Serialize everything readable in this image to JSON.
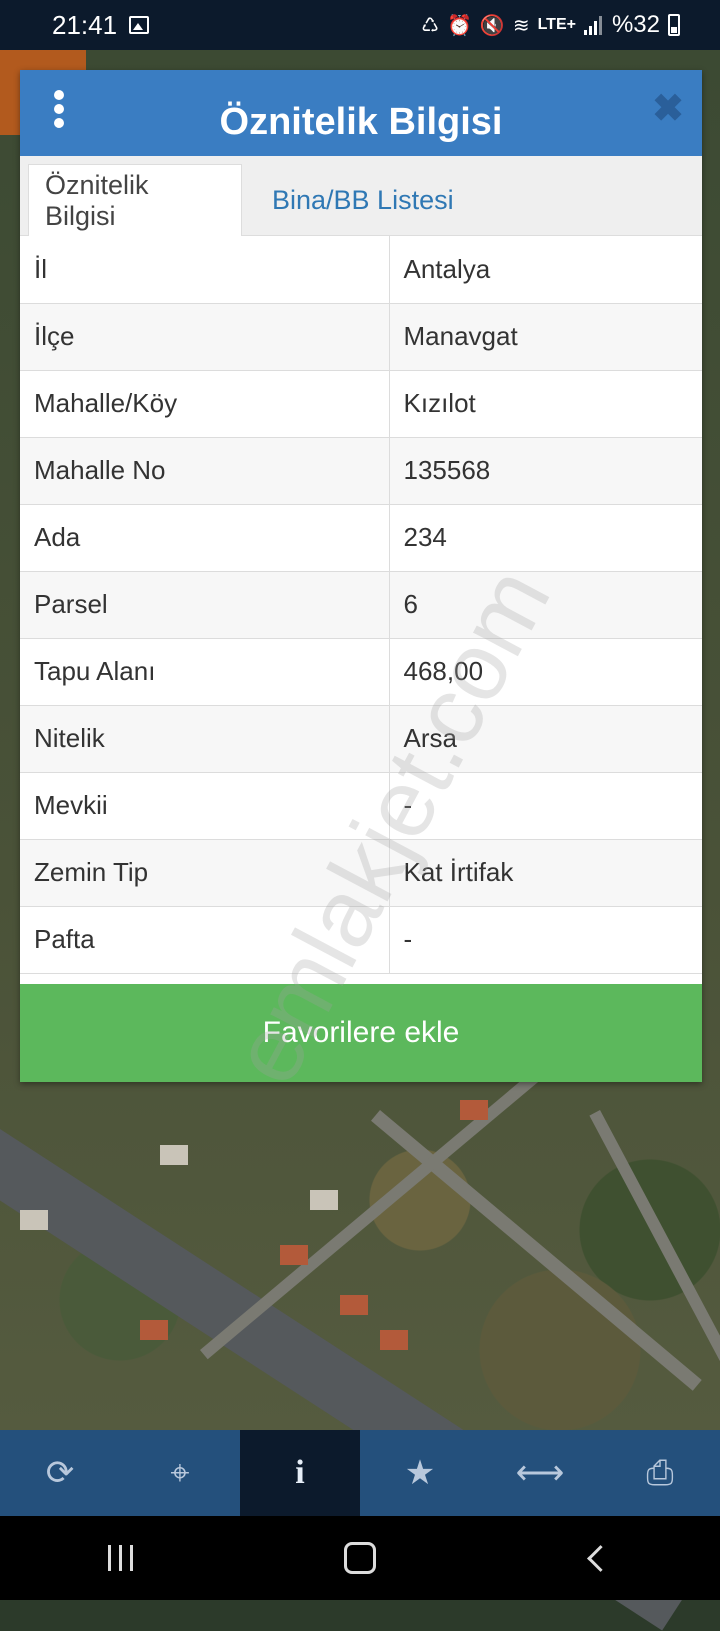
{
  "status_bar": {
    "time": "21:41",
    "battery": "%32",
    "icons": [
      "gallery-icon",
      "battery-saver-icon",
      "alarm-icon",
      "mute-icon",
      "wifi-icon",
      "lte-icon",
      "signal-icon",
      "battery-icon"
    ]
  },
  "dialog": {
    "title": "Öznitelik Bilgisi",
    "tabs": [
      {
        "label": "Öznitelik Bilgisi",
        "active": true
      },
      {
        "label": "Bina/BB Listesi",
        "active": false
      }
    ],
    "rows": [
      {
        "key": "İl",
        "value": "Antalya"
      },
      {
        "key": "İlçe",
        "value": "Manavgat"
      },
      {
        "key": "Mahalle/Köy",
        "value": "Kızılot"
      },
      {
        "key": "Mahalle No",
        "value": "135568"
      },
      {
        "key": "Ada",
        "value": "234"
      },
      {
        "key": "Parsel",
        "value": "6"
      },
      {
        "key": "Tapu Alanı",
        "value": "468,00"
      },
      {
        "key": "Nitelik",
        "value": "Arsa"
      },
      {
        "key": "Mevkii",
        "value": "-"
      },
      {
        "key": "Zemin Tip",
        "value": "Kat İrtifak"
      },
      {
        "key": "Pafta",
        "value": "-"
      }
    ],
    "favorite_label": "Favorilere ekle"
  },
  "watermark": "emlakjet.com",
  "toolbar": {
    "items": [
      {
        "icon": "refresh-icon",
        "glyph": "⟳"
      },
      {
        "icon": "locate-icon",
        "glyph": "⌖"
      },
      {
        "icon": "info-icon",
        "glyph": "i",
        "active": true
      },
      {
        "icon": "star-icon",
        "glyph": "★"
      },
      {
        "icon": "measure-icon",
        "glyph": "⟷"
      },
      {
        "icon": "print-icon",
        "glyph": "⎙"
      }
    ]
  },
  "colors": {
    "header": "#3a7dc2",
    "favorite_button": "#5cb85c",
    "toolbar": "#24507c",
    "tab_link": "#2f78b4"
  }
}
